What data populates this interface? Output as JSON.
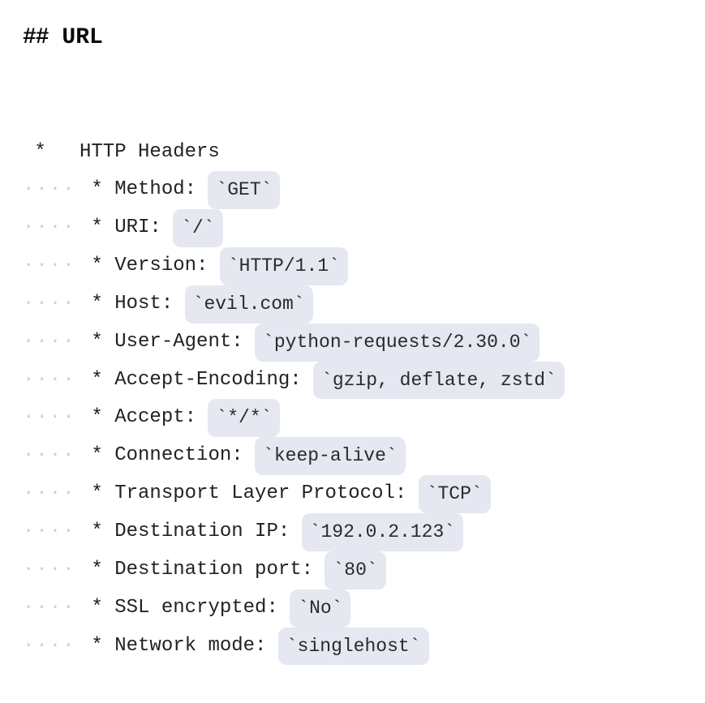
{
  "heading": {
    "hash": "##",
    "title": "URL"
  },
  "top": {
    "bullet": " *   ",
    "label": "HTTP Headers"
  },
  "rows": [
    {
      "label": "Method: ",
      "value": "`GET`"
    },
    {
      "label": "URI: ",
      "value": "`/`"
    },
    {
      "label": "Version: ",
      "value": "`HTTP/1.1`"
    },
    {
      "label": "Host: ",
      "value": "`evil.com`"
    },
    {
      "label": "User-Agent: ",
      "value": "`python-requests/2.30.0`"
    },
    {
      "label": "Accept-Encoding: ",
      "value": "`gzip, deflate, zstd`"
    },
    {
      "label": "Accept: ",
      "value": "`*/*`"
    },
    {
      "label": "Connection: ",
      "value": "`keep-alive`"
    },
    {
      "label": "Transport Layer Protocol: ",
      "value": "`TCP`"
    },
    {
      "label": "Destination IP: ",
      "value": "`192.0.2.123`"
    },
    {
      "label": "Destination port: ",
      "value": "`80`"
    },
    {
      "label": "SSL encrypted: ",
      "value": "`No`"
    },
    {
      "label": "Network mode: ",
      "value": "`singlehost`"
    }
  ],
  "indent": {
    "dots": "····",
    "bullet": " * "
  }
}
